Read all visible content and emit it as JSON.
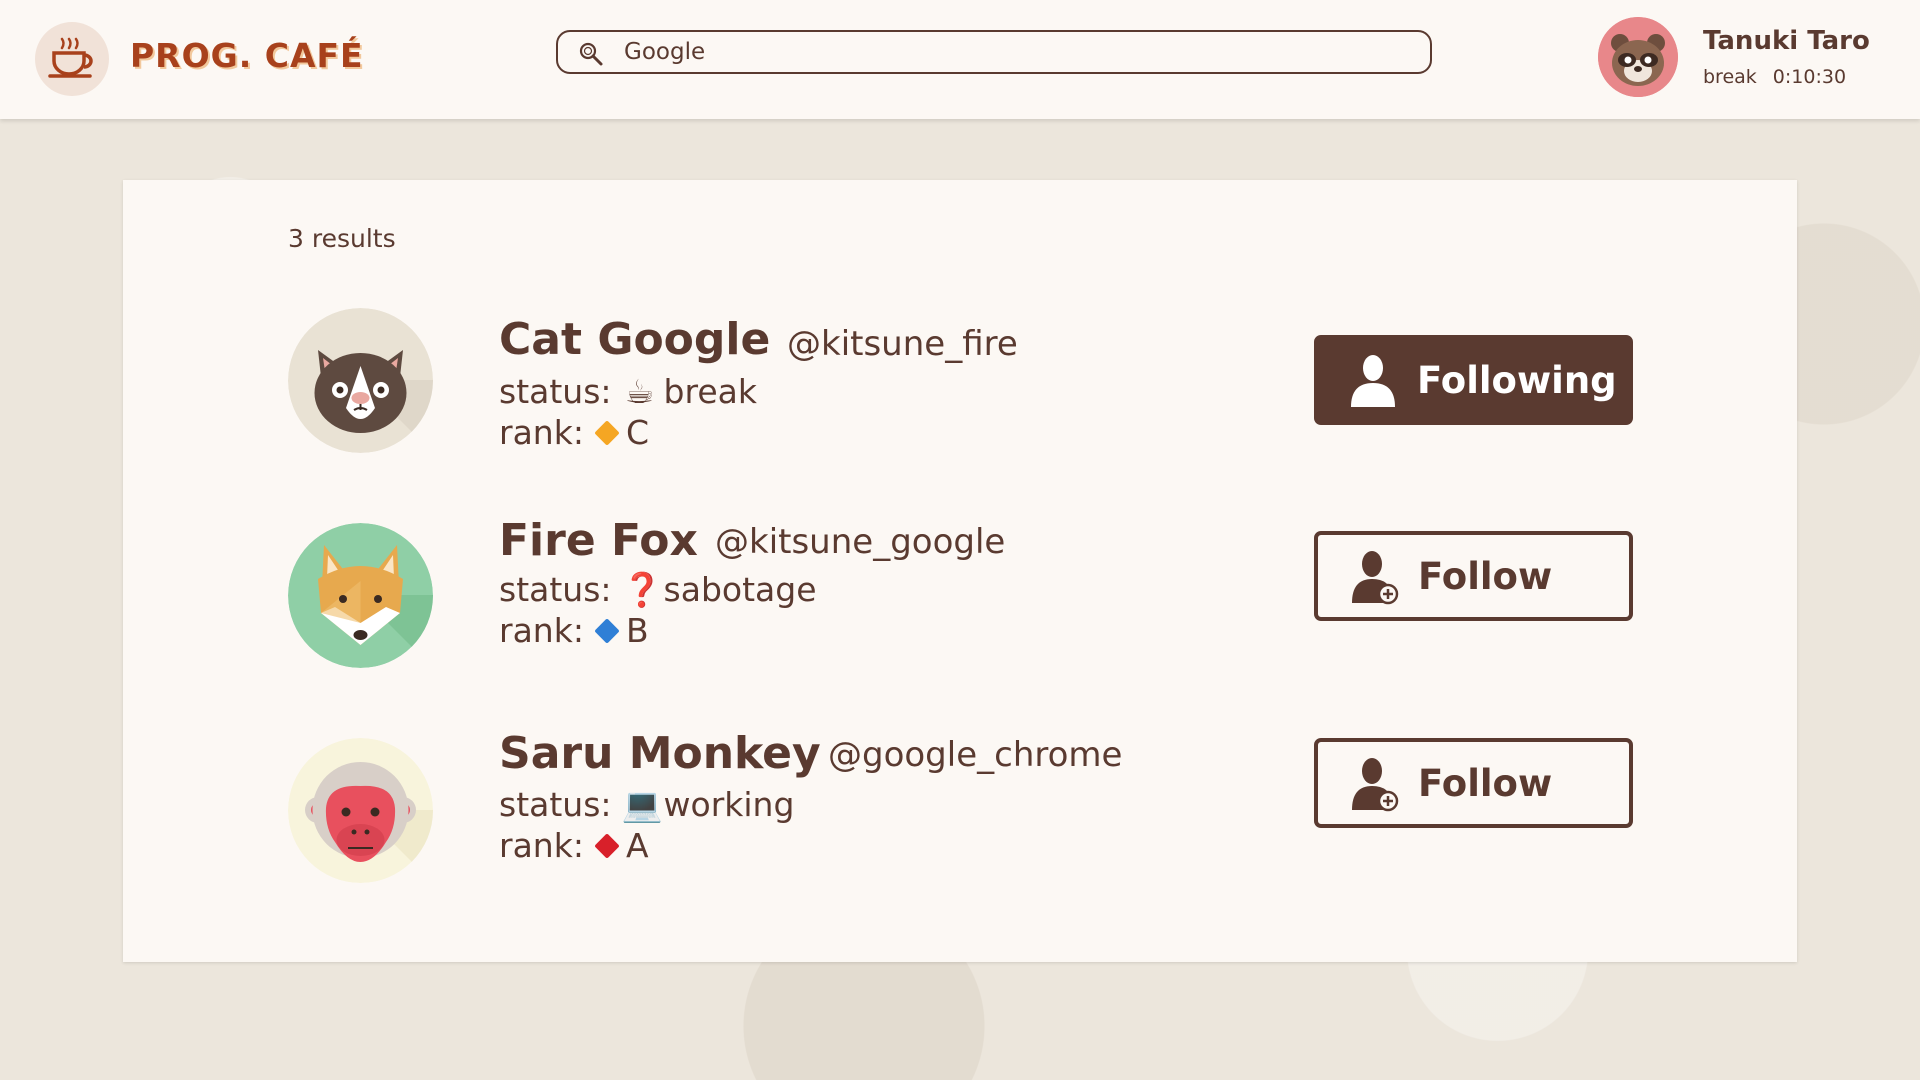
{
  "app": {
    "logo_text": "PROG. CAFÉ",
    "logo_icon": "coffee-cup-icon"
  },
  "search": {
    "value": "Google",
    "icon": "magnifier-icon"
  },
  "me": {
    "name": "Tanuki Taro",
    "status": "break",
    "timer": "0:10:30",
    "avatar": "tanuki-avatar"
  },
  "results_count": "3 results",
  "labels": {
    "status": "status:",
    "rank": "rank:"
  },
  "users": [
    {
      "name": "Cat Google",
      "handle": "@kitsune_fire",
      "status_emoji": "☕",
      "status": "break",
      "rank": "C",
      "rank_color": "#f5a623",
      "avatar": "cat-avatar",
      "button": "Following",
      "following": true
    },
    {
      "name": "Fire Fox",
      "handle": "@kitsune_google",
      "status_emoji": "❓",
      "status": "sabotage",
      "rank": "B",
      "rank_color": "#2f7fd6",
      "avatar": "fox-avatar",
      "button": "Follow",
      "following": false
    },
    {
      "name": "Saru Monkey",
      "handle": "@google_chrome",
      "status_emoji": "💻",
      "status": "working",
      "rank": "A",
      "rank_color": "#d8202a",
      "avatar": "monkey-avatar",
      "button": "Follow",
      "following": false
    }
  ],
  "colors": {
    "brand": "#a8411c",
    "primary": "#5a3a30",
    "surface": "#fcf8f4"
  }
}
